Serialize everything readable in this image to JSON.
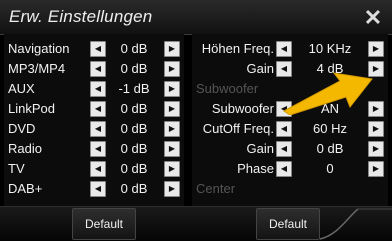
{
  "title": "Erw. Einstellungen",
  "close_label": "✕",
  "left_rows": [
    {
      "label": "Navigation",
      "value": "0 dB"
    },
    {
      "label": "MP3/MP4",
      "value": "0 dB"
    },
    {
      "label": "AUX",
      "value": "-1 dB"
    },
    {
      "label": "LinkPod",
      "value": "0 dB"
    },
    {
      "label": "DVD",
      "value": "0 dB"
    },
    {
      "label": "Radio",
      "value": "0 dB"
    },
    {
      "label": "TV",
      "value": "0 dB"
    },
    {
      "label": "DAB+",
      "value": "0 dB"
    }
  ],
  "right": {
    "hoehen_freq": {
      "label": "Höhen Freq.",
      "value": "10 KHz"
    },
    "gain_1": {
      "label": "Gain",
      "value": "4 dB"
    },
    "subwoofer_section": "Subwoofer",
    "subwoofer": {
      "label": "Subwoofer",
      "value": "AN"
    },
    "cutoff_freq": {
      "label": "CutOff Freq.",
      "value": "60 Hz"
    },
    "gain_2": {
      "label": "Gain",
      "value": "0 dB"
    },
    "phase": {
      "label": "Phase",
      "value": "0"
    },
    "center_section": "Center"
  },
  "bottom": {
    "default_left": "Default",
    "default_right": "Default"
  },
  "icons": {
    "decrement": "arrow-left-icon",
    "increment": "arrow-right-icon",
    "pointer_arrow": "yellow-arrow-icon"
  },
  "colors": {
    "accent": "#f5b800",
    "section_text": "#555555"
  }
}
